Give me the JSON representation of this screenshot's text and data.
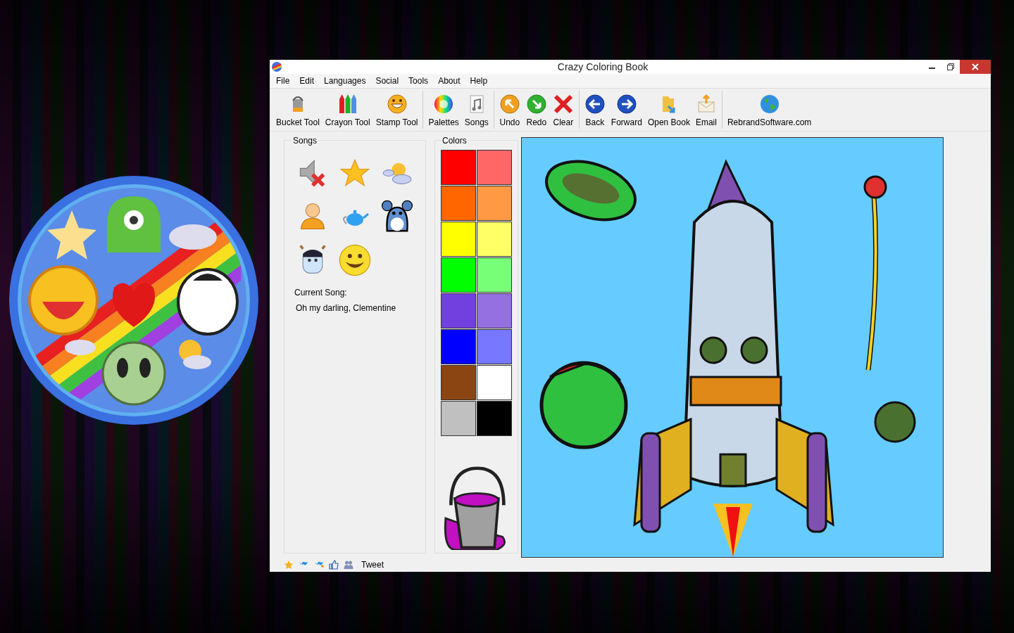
{
  "window": {
    "title": "Crazy Coloring Book"
  },
  "menu": [
    "File",
    "Edit",
    "Languages",
    "Social",
    "Tools",
    "About",
    "Help"
  ],
  "toolbar_groups": [
    [
      {
        "label": "Bucket Tool"
      },
      {
        "label": "Crayon Tool"
      },
      {
        "label": "Stamp Tool"
      }
    ],
    [
      {
        "label": "Palettes"
      },
      {
        "label": "Songs"
      }
    ],
    [
      {
        "label": "Undo"
      },
      {
        "label": "Redo"
      },
      {
        "label": "Clear"
      }
    ],
    [
      {
        "label": "Back"
      },
      {
        "label": "Forward"
      },
      {
        "label": "Open Book"
      },
      {
        "label": "Email"
      }
    ],
    [
      {
        "label": "RebrandSoftware.com"
      }
    ]
  ],
  "songs": {
    "title": "Songs",
    "current_label": "Current Song:",
    "current_song": "Oh my darling, Clementine"
  },
  "colors": {
    "title": "Colors",
    "swatches": [
      {
        "color": "#ff0000"
      },
      {
        "color": "#ff6666"
      },
      {
        "color": "#ff6600"
      },
      {
        "color": "#ff9944"
      },
      {
        "color": "#ffff00"
      },
      {
        "color": "#ffff66"
      },
      {
        "color": "#00ff00"
      },
      {
        "color": "#77ff77"
      },
      {
        "color": "#7340e0"
      },
      {
        "color": "#9470e0"
      },
      {
        "color": "#0000ff"
      },
      {
        "color": "#7777ff"
      },
      {
        "color": "#8b4513"
      },
      {
        "color": "#ffffff"
      },
      {
        "color": "#c0c0c0"
      },
      {
        "color": "#000000"
      }
    ]
  },
  "footer": {
    "tweet": "Tweet"
  }
}
